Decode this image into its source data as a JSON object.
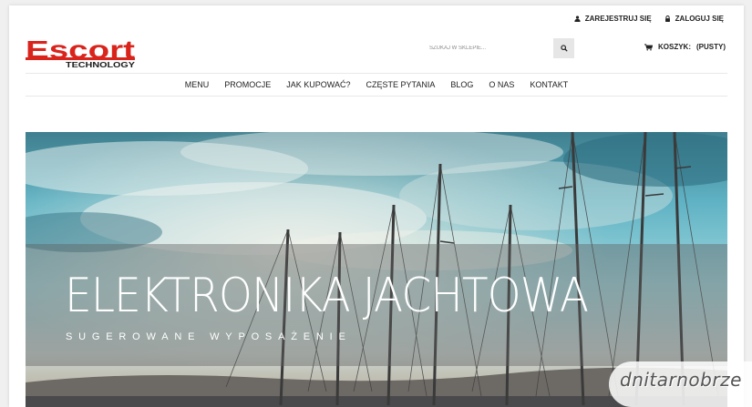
{
  "topbar": {
    "register_label": "ZAREJESTRUJ SIĘ",
    "login_label": "ZALOGUJ SIĘ"
  },
  "logo": {
    "main": "Escort",
    "sub": "TECHNOLOGY",
    "color": "#d9241c"
  },
  "search": {
    "placeholder": "SZUKAJ W SKLEPIE..."
  },
  "cart": {
    "label": "KOSZYK:",
    "status": "(PUSTY)"
  },
  "nav": {
    "items": [
      "MENU",
      "PROMOCJE",
      "JAK KUPOWAĆ?",
      "CZĘSTE PYTANIA",
      "BLOG",
      "O NAS",
      "KONTAKT"
    ]
  },
  "banner": {
    "title": "ELEKTRONIKA JACHTOWA",
    "subtitle": "SUGEROWANE WYPOSAŻENIE"
  },
  "watermark": {
    "text": "dnitarnobrze"
  }
}
